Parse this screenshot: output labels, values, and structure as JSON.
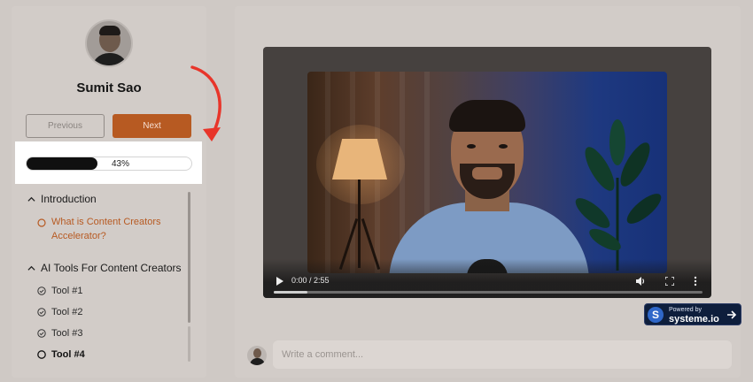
{
  "sidebar": {
    "user_name": "Sumit Sao",
    "prev_label": "Previous",
    "next_label": "Next",
    "progress": {
      "percent": 43,
      "label": "43%"
    },
    "sections": [
      {
        "title": "Introduction",
        "lessons": [
          {
            "label": "What is Content Creators Accelerator?",
            "state": "current"
          }
        ]
      },
      {
        "title": "AI Tools For Content Creators",
        "lessons": [
          {
            "label": "Tool #1",
            "state": "done"
          },
          {
            "label": "Tool #2",
            "state": "done"
          },
          {
            "label": "Tool #3",
            "state": "done"
          },
          {
            "label": "Tool #4",
            "state": "next"
          }
        ]
      }
    ]
  },
  "player": {
    "time": "0:00 / 2:55",
    "icons": [
      "play-icon",
      "volume-icon",
      "fullscreen-icon",
      "more-icon"
    ]
  },
  "badge": {
    "small": "Powered by",
    "big": "systeme.io",
    "letter": "S"
  },
  "comment": {
    "placeholder": "Write a comment..."
  },
  "colors": {
    "accent": "#b75a22",
    "annotation": "#e8352a"
  }
}
